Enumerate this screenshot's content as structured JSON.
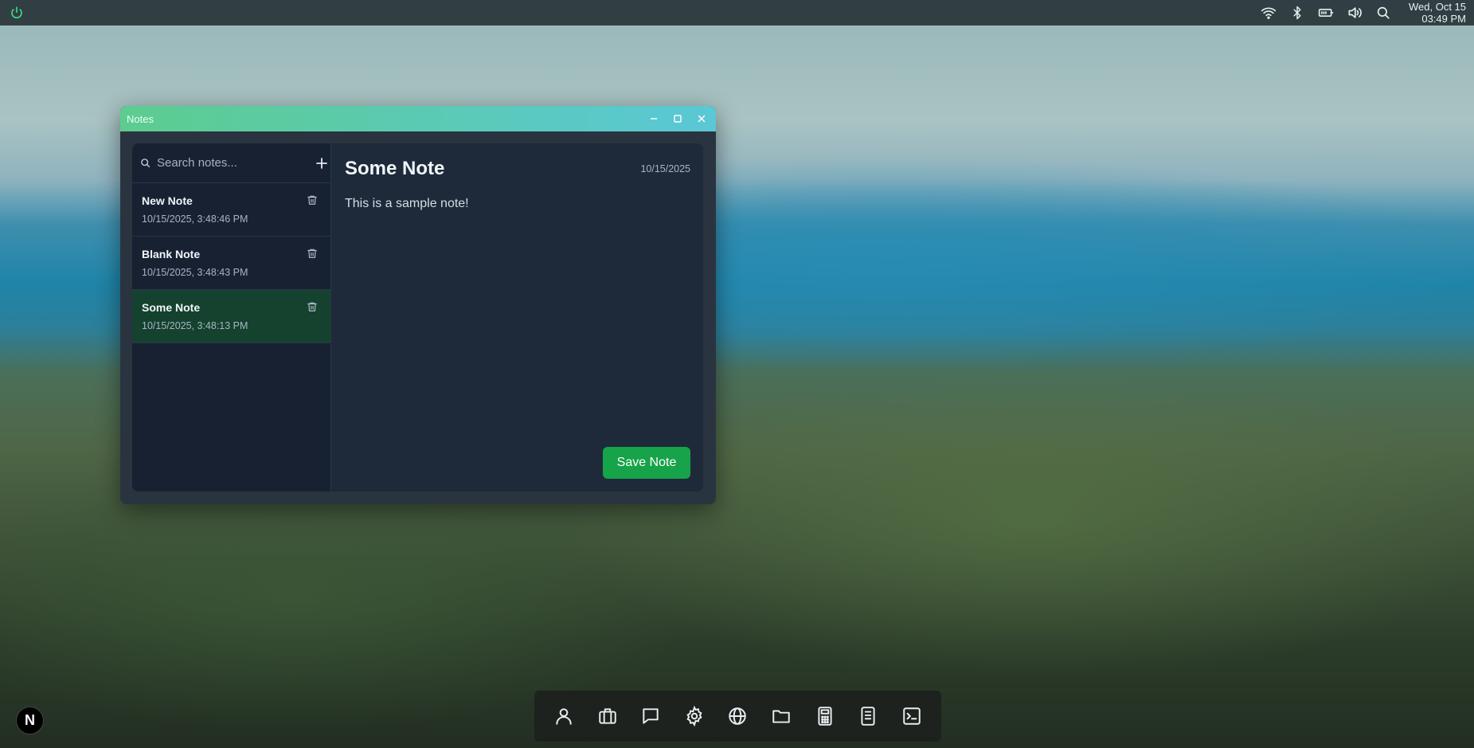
{
  "topbar": {
    "clock_date": "Wed, Oct 15",
    "clock_time": "03:49 PM",
    "tray_icons": [
      "wifi-icon",
      "bluetooth-icon",
      "battery-icon",
      "volume-icon",
      "search-icon"
    ]
  },
  "window": {
    "title": "Notes"
  },
  "sidebar": {
    "search_placeholder": "Search notes...",
    "notes": [
      {
        "title": "New Note",
        "date": "10/15/2025, 3:48:46 PM",
        "active": false
      },
      {
        "title": "Blank Note",
        "date": "10/15/2025, 3:48:43 PM",
        "active": false
      },
      {
        "title": "Some Note",
        "date": "10/15/2025, 3:48:13 PM",
        "active": true
      }
    ]
  },
  "editor": {
    "title": "Some Note",
    "date": "10/15/2025",
    "body": "This is a sample note!",
    "save_label": "Save Note"
  },
  "dock": {
    "items": [
      "user-icon",
      "briefcase-icon",
      "chat-icon",
      "settings-icon",
      "globe-icon",
      "folder-icon",
      "calculator-icon",
      "notebook-icon",
      "terminal-icon"
    ]
  },
  "launcher": {
    "label": "N"
  },
  "colors": {
    "accent": "#16a34a",
    "titlebar_start": "#5ccc8f",
    "titlebar_end": "#5ac8d6",
    "active_note": "#14422e"
  }
}
